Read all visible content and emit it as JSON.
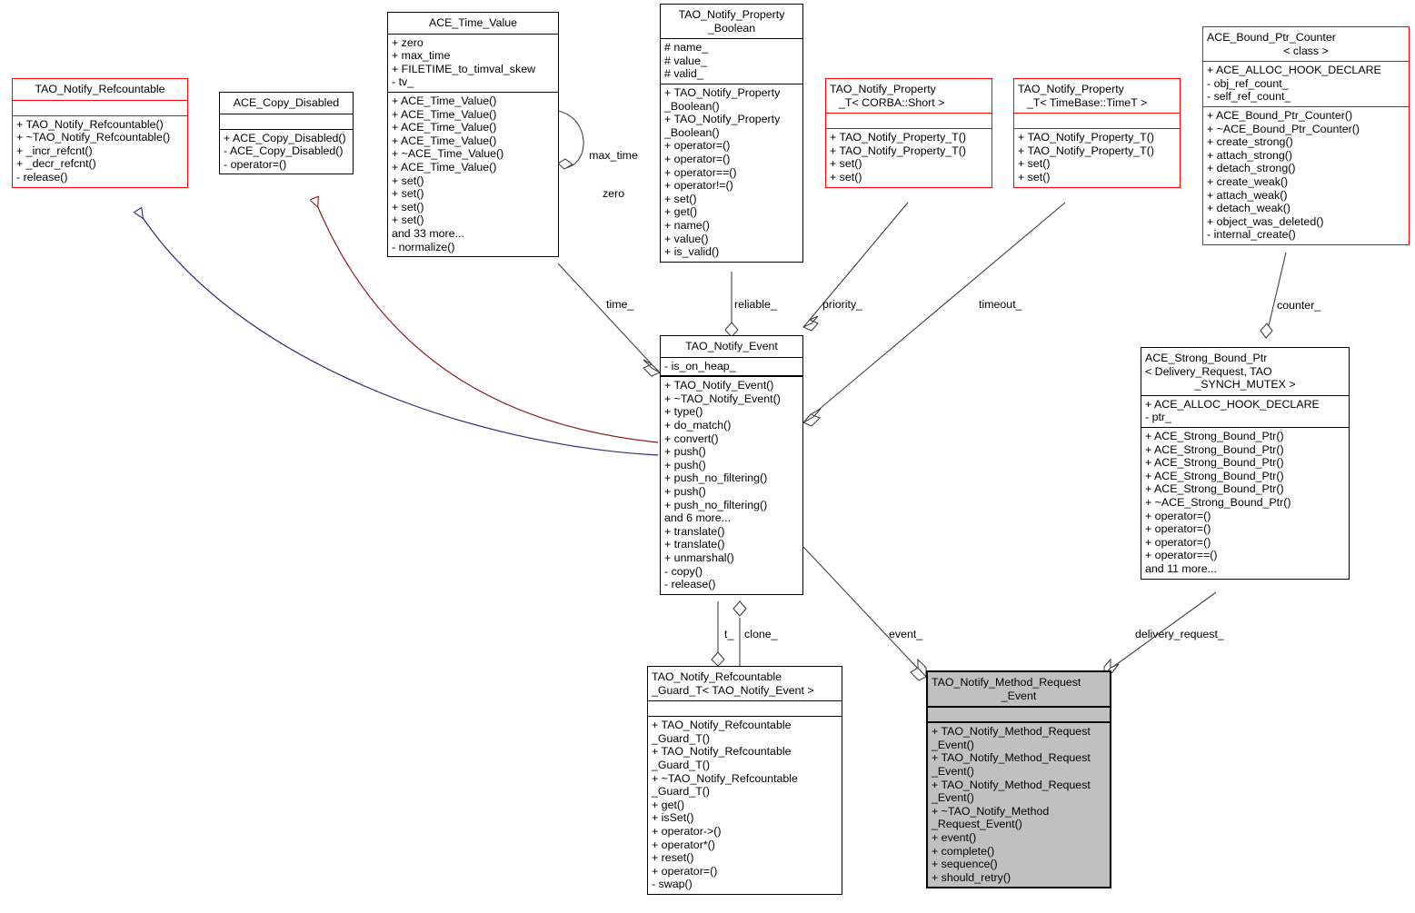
{
  "diagram": {
    "title": "TAO_Notify_Event collaboration diagram",
    "colors": {
      "red_border": "#ff0000",
      "black_border": "#000000",
      "gray_fill": "#c0c0c0",
      "inherit_blue": "#28287f",
      "inherit_red": "#8b1a1a",
      "edge_gray": "#404040"
    }
  },
  "classes": {
    "tao_notify_refcountable": {
      "name": "TAO_Notify_Refcountable",
      "attributes": [],
      "operations": [
        "+ TAO_Notify_Refcountable()",
        "+ ~TAO_Notify_Refcountable()",
        "+ _incr_refcnt()",
        "+ _decr_refcnt()",
        "- release()"
      ]
    },
    "ace_copy_disabled": {
      "name": "ACE_Copy_Disabled",
      "attributes": [],
      "operations": [
        "+ ACE_Copy_Disabled()",
        "- ACE_Copy_Disabled()",
        "- operator=()"
      ]
    },
    "ace_time_value": {
      "name": "ACE_Time_Value",
      "attributes": [
        "+ zero",
        "+ max_time",
        "+ FILETIME_to_timval_skew",
        "- tv_"
      ],
      "operations": [
        "+ ACE_Time_Value()",
        "+ ACE_Time_Value()",
        "+ ACE_Time_Value()",
        "+ ACE_Time_Value()",
        "+ ~ACE_Time_Value()",
        "+ ACE_Time_Value()",
        "+ set()",
        "+ set()",
        "+ set()",
        "+ set()",
        "and 33 more...",
        "- normalize()"
      ]
    },
    "tao_notify_property_boolean": {
      "name_line1": "TAO_Notify_Property",
      "name_line2": "_Boolean",
      "attributes": [
        "# name_",
        "# value_",
        "# valid_"
      ],
      "operations": [
        "+ TAO_Notify_Property",
        "_Boolean()",
        "+ TAO_Notify_Property",
        "_Boolean()",
        "+ operator=()",
        "+ operator=()",
        "+ operator==()",
        "+ operator!=()",
        "+ set()",
        "+ get()",
        "+ name()",
        "+ value()",
        "+ is_valid()"
      ]
    },
    "tao_notify_property_t_short": {
      "name_line1": "TAO_Notify_Property",
      "name_line2": "_T< CORBA::Short >",
      "attributes": [],
      "operations": [
        "+ TAO_Notify_Property_T()",
        "+ TAO_Notify_Property_T()",
        "+ set()",
        "+ set()"
      ]
    },
    "tao_notify_property_t_timet": {
      "name_line1": "TAO_Notify_Property",
      "name_line2": "_T< TimeBase::TimeT >",
      "attributes": [],
      "operations": [
        "+ TAO_Notify_Property_T()",
        "+ TAO_Notify_Property_T()",
        "+ set()",
        "+ set()"
      ]
    },
    "ace_bound_ptr_counter": {
      "name_line1": "ACE_Bound_Ptr_Counter",
      "name_line2": "< class >",
      "attributes": [
        "+ ACE_ALLOC_HOOK_DECLARE",
        "- obj_ref_count_",
        "- self_ref_count_"
      ],
      "operations": [
        "+ ACE_Bound_Ptr_Counter()",
        "+ ~ACE_Bound_Ptr_Counter()",
        "+ create_strong()",
        "+ attach_strong()",
        "+ detach_strong()",
        "+ create_weak()",
        "+ attach_weak()",
        "+ detach_weak()",
        "+ object_was_deleted()",
        "- internal_create()"
      ]
    },
    "tao_notify_event": {
      "name": "TAO_Notify_Event",
      "attributes": [
        "- is_on_heap_"
      ],
      "operations": [
        "+ TAO_Notify_Event()",
        "+ ~TAO_Notify_Event()",
        "+ type()",
        "+ do_match()",
        "+ convert()",
        "+ push()",
        "+ push()",
        "+ push_no_filtering()",
        "+ push()",
        "+ push_no_filtering()",
        "and 6 more...",
        "+ translate()",
        "+ translate()",
        "+ unmarshal()",
        "- copy()",
        "- release()"
      ]
    },
    "ace_strong_bound_ptr": {
      "name_line1": "ACE_Strong_Bound_Ptr",
      "name_line2": "< Delivery_Request, TAO",
      "name_line3": "_SYNCH_MUTEX >",
      "attributes": [
        "+ ACE_ALLOC_HOOK_DECLARE",
        "- ptr_"
      ],
      "operations": [
        "+ ACE_Strong_Bound_Ptr()",
        "+ ACE_Strong_Bound_Ptr()",
        "+ ACE_Strong_Bound_Ptr()",
        "+ ACE_Strong_Bound_Ptr()",
        "+ ACE_Strong_Bound_Ptr()",
        "+ ~ACE_Strong_Bound_Ptr()",
        "+ operator=()",
        "+ operator=()",
        "+ operator=()",
        "+ operator==()",
        "and 11 more..."
      ]
    },
    "tao_notify_refcountable_guard_t": {
      "name_line1": "TAO_Notify_Refcountable",
      "name_line2": "_Guard_T< TAO_Notify_Event >",
      "attributes": [],
      "operations": [
        "+ TAO_Notify_Refcountable",
        "_Guard_T()",
        "+ TAO_Notify_Refcountable",
        "_Guard_T()",
        "+ ~TAO_Notify_Refcountable",
        "_Guard_T()",
        "+ get()",
        "+ isSet()",
        "+ operator->()",
        "+ operator*()",
        "+ reset()",
        "+ operator=()",
        "- swap()"
      ]
    },
    "tao_notify_method_request_event": {
      "name_line1": "TAO_Notify_Method_Request",
      "name_line2": "_Event",
      "attributes": [],
      "operations": [
        "+ TAO_Notify_Method_Request",
        "_Event()",
        "+ TAO_Notify_Method_Request",
        "_Event()",
        "+ TAO_Notify_Method_Request",
        "_Event()",
        "+ ~TAO_Notify_Method",
        "_Request_Event()",
        "+ event()",
        "+ complete()",
        "+ sequence()",
        "+ should_retry()"
      ]
    }
  },
  "edge_labels": {
    "max_time": "max_time",
    "zero": "zero",
    "time": "time_",
    "reliable": "reliable_",
    "priority": "priority_",
    "timeout": "timeout_",
    "counter": "counter_",
    "t": "t_",
    "clone": "clone_",
    "event": "event_",
    "delivery_request": "delivery_request_"
  }
}
